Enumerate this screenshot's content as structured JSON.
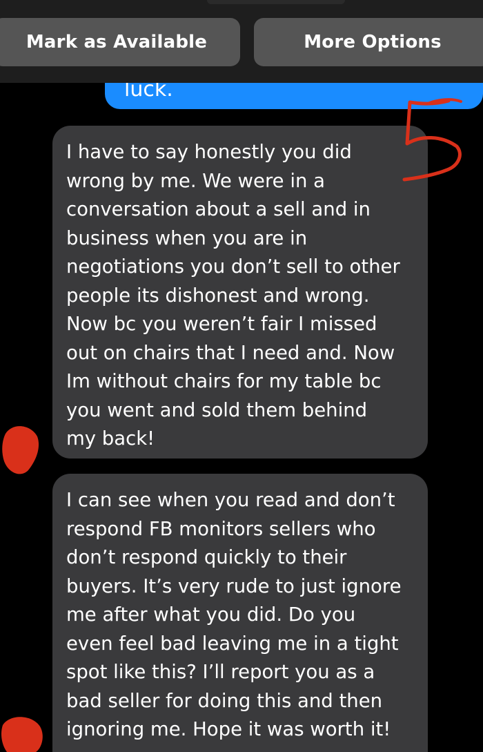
{
  "action_bar": {
    "mark_available_label": "Mark as Available",
    "more_options_label": "More Options"
  },
  "messages": {
    "outgoing_partial": "luck.",
    "incoming": [
      "I have to say honestly you did\nwrong by me. We were in a\nconversation about a sell and in\nbusiness when you are in\nnegotiations you don’t sell to other\npeople its dishonest and wrong.\nNow bc you weren’t fair I missed\nout on chairs that I need and. Now\nIm without chairs for my table bc\nyou went and sold them behind\nmy back!",
      "I can see when you read and don’t\nrespond FB monitors sellers who\ndon’t respond quickly to their\nbuyers. It’s very rude to just ignore\nme after what you did. Do you\neven feel bad leaving me in a tight\nspot like this? I’ll report you as a\nbad seller for doing this and then\nignoring me. Hope it was worth it!"
    ]
  },
  "annotation": {
    "number": "5",
    "ink_color": "#d9301a"
  },
  "colors": {
    "background": "#000000",
    "button_bg": "#555555",
    "outgoing_bubble": "#1a8cff",
    "incoming_bubble": "#3a3a3c"
  }
}
